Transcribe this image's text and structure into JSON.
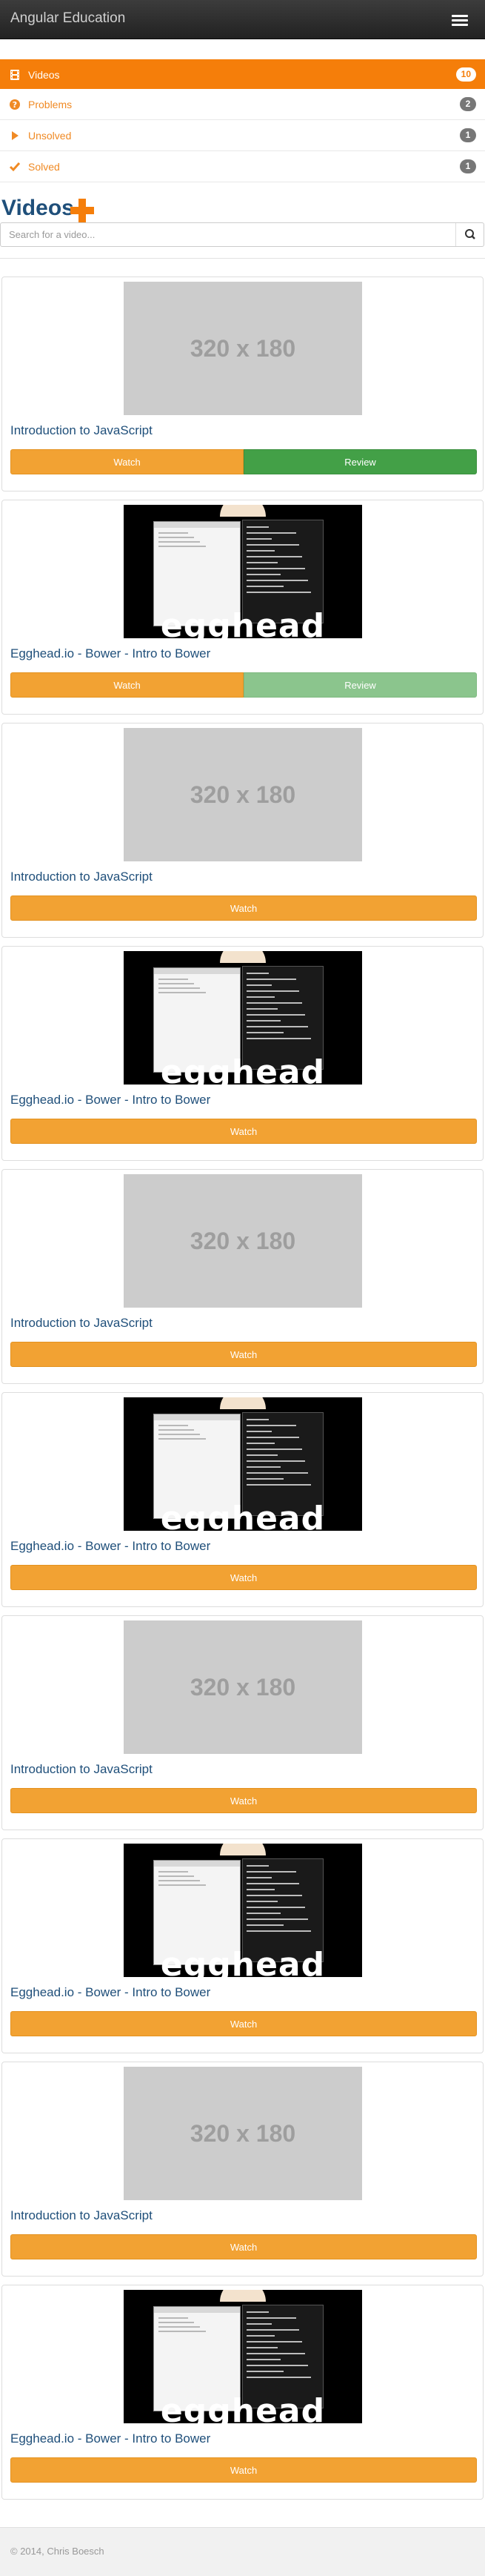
{
  "navbar": {
    "brand": "Angular Education",
    "menu_icon": "hamburger-menu-icon"
  },
  "nav": [
    {
      "label": "Videos",
      "badge": "10",
      "icon": "film-icon",
      "active": true
    },
    {
      "label": "Problems",
      "badge": "2",
      "icon": "question-circle-icon",
      "active": false
    },
    {
      "label": "Unsolved",
      "badge": "1",
      "icon": "play-triangle-icon",
      "active": false
    },
    {
      "label": "Solved",
      "badge": "1",
      "icon": "checkmark-icon",
      "active": false
    }
  ],
  "main": {
    "heading": "Videos",
    "add_icon": "plus-icon",
    "search": {
      "placeholder": "Search for a video...",
      "value": "",
      "icon": "search-icon"
    }
  },
  "cards": [
    {
      "title": "Introduction to JavaScript",
      "thumb": "placeholder",
      "thumb_text": "320 x 180",
      "watch": "Watch",
      "review": "Review"
    },
    {
      "title": "Egghead.io - Bower - Intro to Bower",
      "thumb": "egghead",
      "thumb_text": "egghead",
      "watch": "Watch",
      "review": "Review"
    },
    {
      "title": "Introduction to JavaScript",
      "thumb": "placeholder",
      "thumb_text": "320 x 180",
      "watch": "Watch"
    },
    {
      "title": "Egghead.io - Bower - Intro to Bower",
      "thumb": "egghead",
      "thumb_text": "egghead",
      "watch": "Watch"
    },
    {
      "title": "Introduction to JavaScript",
      "thumb": "placeholder",
      "thumb_text": "320 x 180",
      "watch": "Watch"
    },
    {
      "title": "Egghead.io - Bower - Intro to Bower",
      "thumb": "egghead",
      "thumb_text": "egghead",
      "watch": "Watch"
    },
    {
      "title": "Introduction to JavaScript",
      "thumb": "placeholder",
      "thumb_text": "320 x 180",
      "watch": "Watch"
    },
    {
      "title": "Egghead.io - Bower - Intro to Bower",
      "thumb": "egghead",
      "thumb_text": "egghead",
      "watch": "Watch"
    },
    {
      "title": "Introduction to JavaScript",
      "thumb": "placeholder",
      "thumb_text": "320 x 180",
      "watch": "Watch"
    },
    {
      "title": "Egghead.io - Bower - Intro to Bower",
      "thumb": "egghead",
      "thumb_text": "egghead",
      "watch": "Watch"
    }
  ],
  "footer": {
    "text": "© 2014, Chris Boesch"
  },
  "colors": {
    "accent": "#f57e0a",
    "title_blue": "#1f4f7a",
    "watch": "#f2a233",
    "review": "#43a047",
    "review_light": "#8bc58d",
    "navbar": "#2b2b2b"
  }
}
